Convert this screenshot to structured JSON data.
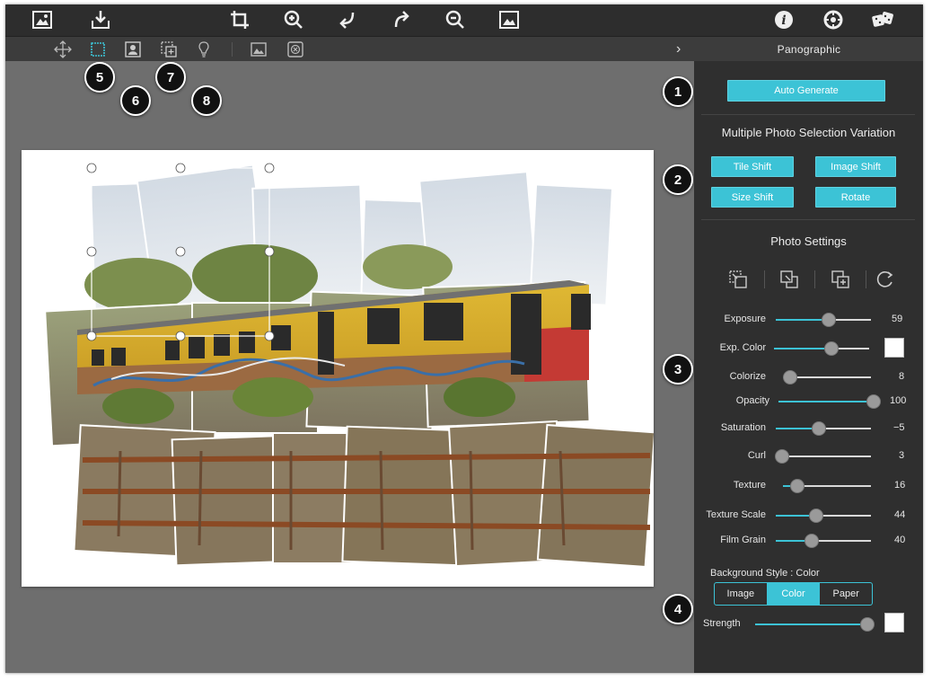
{
  "toolbar": {
    "icons": [
      "image-open-icon",
      "import-icon",
      "crop-icon",
      "zoom-in-icon",
      "undo-icon",
      "redo-icon",
      "zoom-out-icon",
      "export-image-icon",
      "info-icon",
      "settings-icon",
      "dice-icon"
    ]
  },
  "subtoolbar": {
    "icons": [
      "move-icon",
      "select-rect-icon",
      "select-person-icon",
      "add-tile-icon",
      "lightbulb-icon",
      "image-icon",
      "remove-icon"
    ],
    "chevron": "›"
  },
  "panel": {
    "title": "Panographic",
    "auto_generate": "Auto Generate",
    "variation_title": "Multiple Photo Selection Variation",
    "variation_buttons": [
      "Tile Shift",
      "Image Shift",
      "Size Shift",
      "Rotate"
    ],
    "photo_settings_title": "Photo Settings",
    "sliders": [
      {
        "label": "Exposure",
        "value": "59",
        "fraction": 0.56
      },
      {
        "label": "Exp. Color",
        "value": "",
        "fraction": 0.6
      },
      {
        "label": "Colorize",
        "value": "8",
        "fraction": 0.08
      },
      {
        "label": "Opacity",
        "value": "100",
        "fraction": 1.0
      },
      {
        "label": "Saturation",
        "value": "−5",
        "fraction": 0.45
      },
      {
        "label": "Curl",
        "value": "3",
        "fraction": 0.03
      },
      {
        "label": "Texture",
        "value": "16",
        "fraction": 0.16
      },
      {
        "label": "Texture Scale",
        "value": "44",
        "fraction": 0.42
      },
      {
        "label": "Film Grain",
        "value": "40",
        "fraction": 0.38
      }
    ],
    "background_style_label": "Background Style : Color",
    "background_options": [
      "Image",
      "Color",
      "Paper"
    ],
    "background_selected": "Color",
    "strength_label": "Strength",
    "strength_fraction": 0.96
  },
  "badges": [
    "1",
    "2",
    "3",
    "4",
    "5",
    "6",
    "7",
    "8"
  ],
  "colors": {
    "accent": "#3cc3d6",
    "panel": "#2f2f2f",
    "workspace": "#6e6e6e"
  }
}
